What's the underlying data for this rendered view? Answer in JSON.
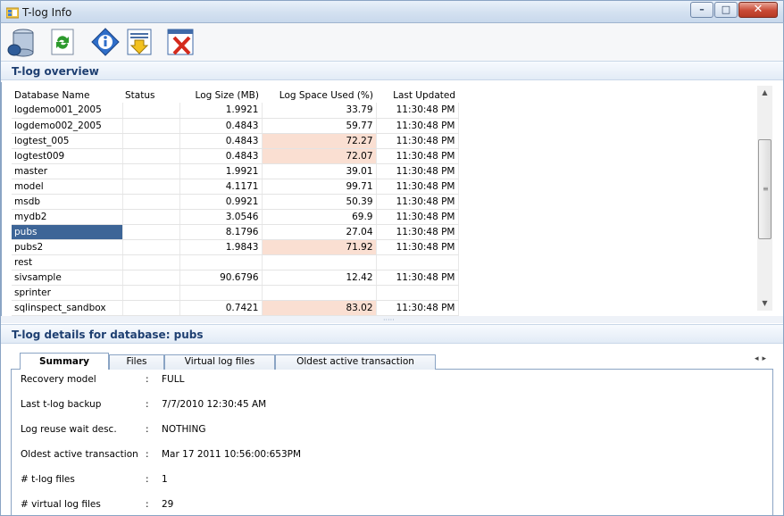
{
  "window": {
    "title": "T-log Info",
    "minimize_glyph": "–",
    "maximize_glyph": "□",
    "close_glyph": "✕"
  },
  "toolbar": {
    "buttons": [
      {
        "icon": "database-icon"
      },
      {
        "icon": "refresh-icon"
      },
      {
        "icon": "info-icon"
      },
      {
        "icon": "export-icon"
      },
      {
        "icon": "close-window-icon"
      }
    ]
  },
  "overview": {
    "header": "T-log overview",
    "columns": [
      "Database Name",
      "Status",
      "Log Size (MB)",
      "Log Space Used (%)",
      "Last Updated"
    ],
    "rows": [
      {
        "name": "logdemo001_2005",
        "status": "",
        "size": "1.9921",
        "used": "33.79",
        "updated": "11:30:48 PM",
        "highlight": false
      },
      {
        "name": "logdemo002_2005",
        "status": "",
        "size": "0.4843",
        "used": "59.77",
        "updated": "11:30:48 PM",
        "highlight": false
      },
      {
        "name": "logtest_005",
        "status": "",
        "size": "0.4843",
        "used": "72.27",
        "updated": "11:30:48 PM",
        "highlight": true
      },
      {
        "name": "logtest009",
        "status": "",
        "size": "0.4843",
        "used": "72.07",
        "updated": "11:30:48 PM",
        "highlight": true
      },
      {
        "name": "master",
        "status": "",
        "size": "1.9921",
        "used": "39.01",
        "updated": "11:30:48 PM",
        "highlight": false
      },
      {
        "name": "model",
        "status": "",
        "size": "4.1171",
        "used": "99.71",
        "updated": "11:30:48 PM",
        "highlight": false
      },
      {
        "name": "msdb",
        "status": "",
        "size": "0.9921",
        "used": "50.39",
        "updated": "11:30:48 PM",
        "highlight": false
      },
      {
        "name": "mydb2",
        "status": "",
        "size": "3.0546",
        "used": "69.9",
        "updated": "11:30:48 PM",
        "highlight": false
      },
      {
        "name": "pubs",
        "status": "",
        "size": "8.1796",
        "used": "27.04",
        "updated": "11:30:48 PM",
        "highlight": false,
        "selected": true
      },
      {
        "name": "pubs2",
        "status": "",
        "size": "1.9843",
        "used": "71.92",
        "updated": "11:30:48 PM",
        "highlight": true
      },
      {
        "name": "rest",
        "status": "",
        "size": "",
        "used": "",
        "updated": "",
        "highlight": false
      },
      {
        "name": "sivsample",
        "status": "",
        "size": "90.6796",
        "used": "12.42",
        "updated": "11:30:48 PM",
        "highlight": false
      },
      {
        "name": "sprinter",
        "status": "",
        "size": "",
        "used": "",
        "updated": "",
        "highlight": false
      },
      {
        "name": "sqlinspect_sandbox",
        "status": "",
        "size": "0.7421",
        "used": "83.02",
        "updated": "11:30:48 PM",
        "highlight": true
      }
    ],
    "highlight_color": "#fadfd2",
    "selected_color": "#3d6597"
  },
  "details": {
    "header": "T-log details for database: pubs",
    "tabs": [
      "Summary",
      "Files",
      "Virtual log files",
      "Oldest active transaction"
    ],
    "active_tab": "Summary",
    "separator": ":",
    "fields": [
      {
        "label": "Recovery model",
        "value": "FULL"
      },
      {
        "label": "Last t-log backup",
        "value": "7/7/2010 12:30:45 AM"
      },
      {
        "label": "Log reuse wait desc.",
        "value": "NOTHING"
      },
      {
        "label": "Oldest active transaction",
        "value": "Mar 17 2011 10:56:00:653PM"
      },
      {
        "label": "# t-log files",
        "value": "1"
      },
      {
        "label": "# virtual log files",
        "value": "29"
      }
    ]
  },
  "colors": {
    "header_text": "#1e3f71",
    "border": "#8aa4c4"
  }
}
